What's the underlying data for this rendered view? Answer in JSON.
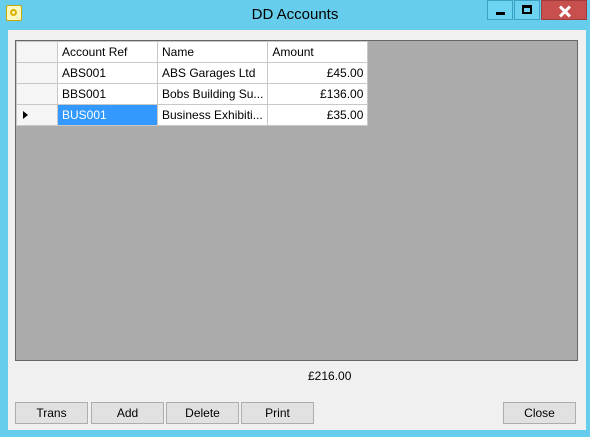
{
  "window": {
    "title": "DD Accounts"
  },
  "grid": {
    "columns": [
      "Account Ref",
      "Name",
      "Amount"
    ],
    "rows": [
      {
        "ref": "ABS001",
        "name": "ABS Garages Ltd",
        "amount": "£45.00"
      },
      {
        "ref": "BBS001",
        "name": "Bobs Building Su...",
        "amount": "£136.00"
      },
      {
        "ref": "BUS001",
        "name": "Business Exhibiti...",
        "amount": "£35.00"
      }
    ]
  },
  "total": "£216.00",
  "buttons": {
    "trans": "Trans",
    "add": "Add",
    "delete": "Delete",
    "print": "Print",
    "close": "Close"
  }
}
